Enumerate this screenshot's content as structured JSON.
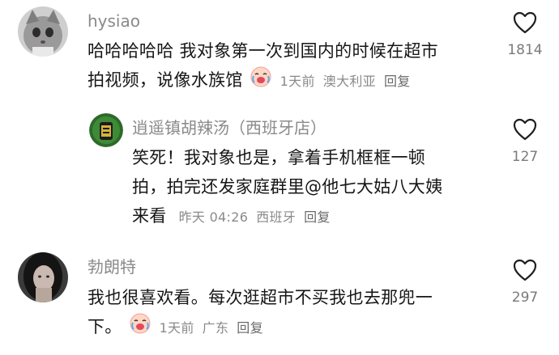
{
  "comments": [
    {
      "username": "hysiao",
      "text_line1": "哈哈哈哈哈 我对象第一次到国内的时候在超市",
      "text_line2": "拍视频，说像水族馆",
      "emoji_icon": "crying-laughing-baby-emoji",
      "time": "1天前",
      "location": "澳大利亚",
      "reply": "回复",
      "likes": "1814"
    },
    {
      "username": "逍遥镇胡辣汤（西班牙店）",
      "text_line1": "笑死！我对象也是，拿着手机框框一顿",
      "text_line2": "拍，拍完还发家庭群里@他七大姑八大姨",
      "text_line3": "来看",
      "time": "昨天 04:26",
      "location": "西班牙",
      "reply": "回复",
      "likes": "127"
    },
    {
      "username": "勃朗特",
      "text_line1": "我也很喜欢看。每次逛超市不买我也去那兜一",
      "text_line2": "下。",
      "emoji_icon": "crying-laughing-baby-emoji",
      "time": "1天前",
      "location": "广东",
      "reply": "回复",
      "likes": "297"
    }
  ],
  "colors": {
    "text": "#161616",
    "secondary": "#8a8a8a",
    "heart_outline": "#1f1f1f"
  }
}
